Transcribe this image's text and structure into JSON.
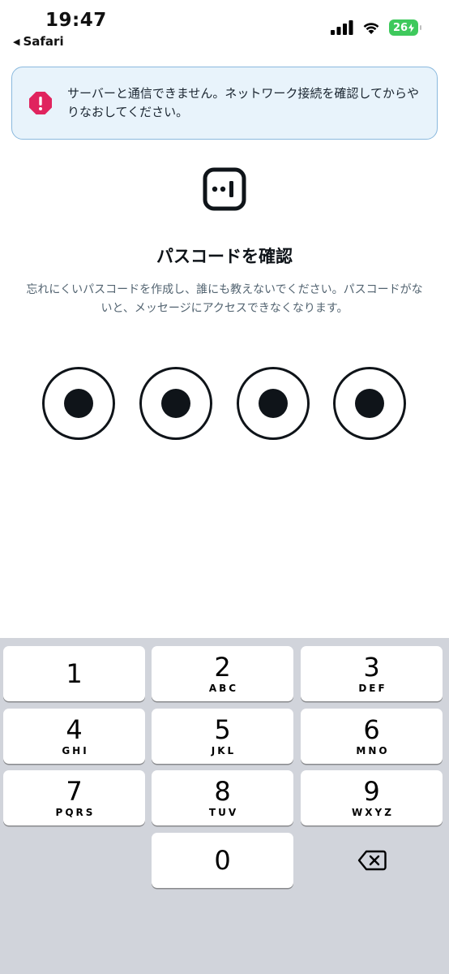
{
  "status_bar": {
    "time": "19:47",
    "back_app": "Safari",
    "back_icon": "back-triangle-icon",
    "battery_level": "26",
    "charging": true
  },
  "banner": {
    "icon": "error-octagon-icon",
    "icon_color": "#e0245e",
    "message": "サーバーと通信できません。ネットワーク接続を確認してからやりなおしてください。"
  },
  "logo": {
    "icon": "messages-lock-icon"
  },
  "title": "パスコードを確認",
  "subtitle": "忘れにくいパスコードを作成し、誰にも教えないでください。パスコードがないと、メッセージにアクセスできなくなります。",
  "passcode": {
    "length": 4,
    "filled": 4
  },
  "keypad": {
    "keys": [
      {
        "digit": "1",
        "letters": ""
      },
      {
        "digit": "2",
        "letters": "ABC"
      },
      {
        "digit": "3",
        "letters": "DEF"
      },
      {
        "digit": "4",
        "letters": "GHI"
      },
      {
        "digit": "5",
        "letters": "JKL"
      },
      {
        "digit": "6",
        "letters": "MNO"
      },
      {
        "digit": "7",
        "letters": "PQRS"
      },
      {
        "digit": "8",
        "letters": "TUV"
      },
      {
        "digit": "9",
        "letters": "WXYZ"
      },
      {
        "digit": "0",
        "letters": ""
      }
    ],
    "delete_icon": "delete-backspace-icon"
  },
  "colors": {
    "banner_bg": "#e8f3fb",
    "banner_border": "#8ab9de",
    "keyboard_bg": "#d1d4db",
    "battery": "#3ec95c"
  }
}
